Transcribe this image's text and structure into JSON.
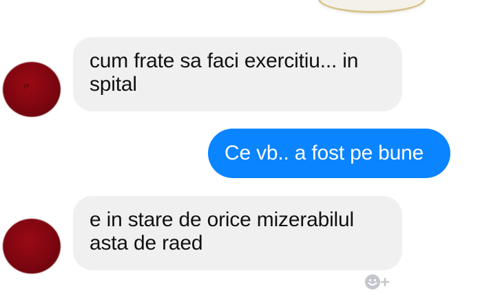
{
  "conversation": {
    "messages": [
      {
        "direction": "incoming",
        "text": "cum frate sa faci exercitiu... in spital"
      },
      {
        "direction": "outgoing",
        "text": "Ce vb.. a fost pe bune"
      },
      {
        "direction": "incoming",
        "text": "e in stare de orice mizerabilul asta de raed"
      }
    ]
  },
  "icons": {
    "reaction": "smiley-plus-icon",
    "top_partial": "sticker-icon"
  },
  "colors": {
    "incoming_bubble": "#f0f0f0",
    "outgoing_bubble": "#0a84ff",
    "avatar": "#8b0a12",
    "background": "#ffffff"
  }
}
